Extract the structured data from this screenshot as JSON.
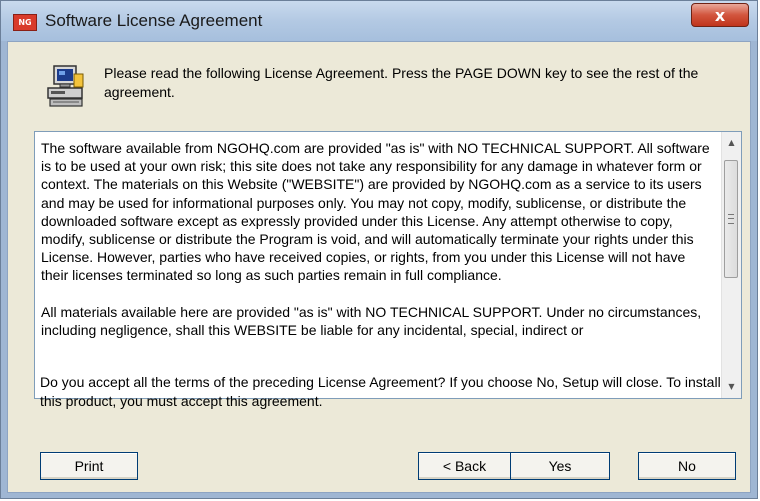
{
  "window": {
    "title": "Software License Agreement",
    "app_icon_text": "NG",
    "close_glyph": "x"
  },
  "header": {
    "icon": "computer-setup-icon",
    "instruction": "Please read the following License Agreement. Press the PAGE DOWN key to see the rest of the agreement."
  },
  "license": {
    "paragraphs": [
      "The software available from NGOHQ.com are provided \"as is\" with NO TECHNICAL SUPPORT. All software is to be used at your own risk; this site does not take any responsibility for any damage in whatever form or context. The materials on this Website (\"WEBSITE\") are provided by NGOHQ.com as a service to its users and may be used for informational purposes only. You may not copy, modify, sublicense, or distribute the downloaded software except as expressly provided under this License. Any attempt otherwise to copy, modify, sublicense or distribute the Program is void, and will automatically terminate your rights under this License. However, parties who have received copies, or rights, from you under this License will not have their licenses terminated so long as such parties remain in full compliance.",
      "All materials available here are provided \"as is\" with NO TECHNICAL SUPPORT. Under no circumstances, including negligence, shall this WEBSITE be liable for any incidental, special, indirect or"
    ],
    "scroll_up_glyph": "▲",
    "scroll_down_glyph": "▼"
  },
  "question": "Do you accept all the terms of the preceding License Agreement? If you choose No, Setup will close. To install this product, you must accept this agreement.",
  "buttons": {
    "print": "Print",
    "back": "< Back",
    "yes": "Yes",
    "no": "No"
  }
}
